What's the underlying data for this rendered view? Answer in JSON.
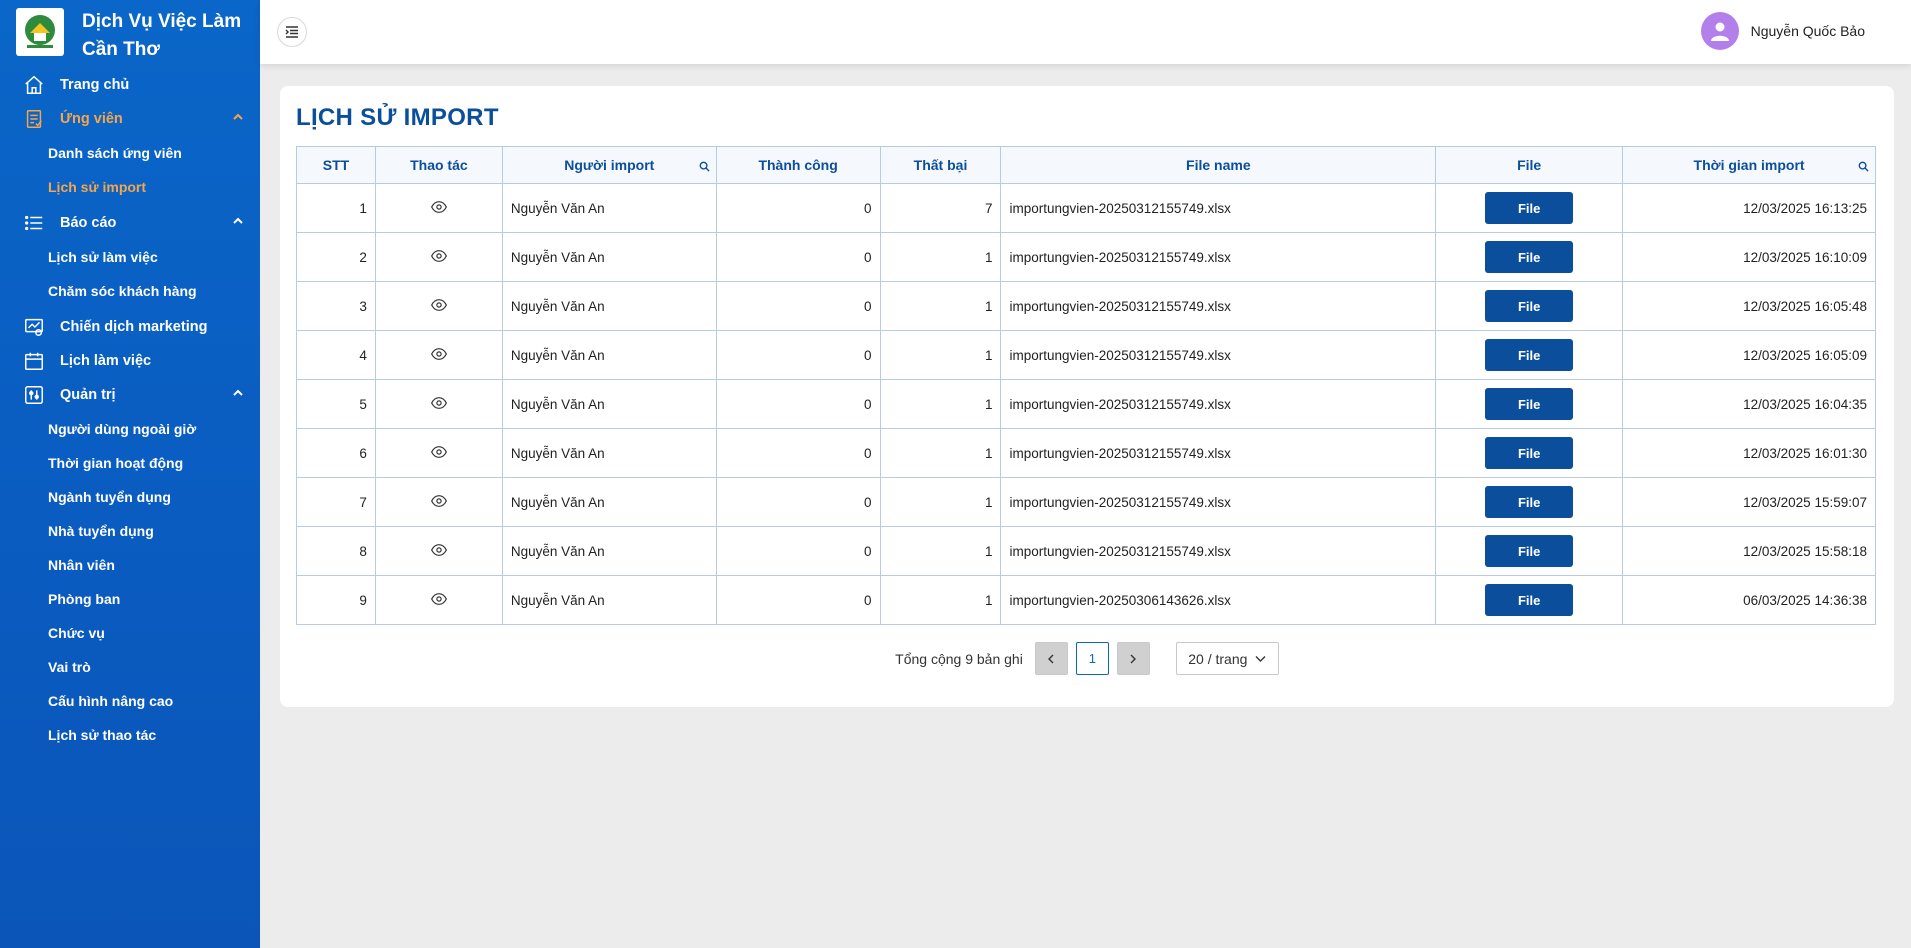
{
  "brand": {
    "name": "Dịch Vụ Việc Làm Cần Thơ"
  },
  "sidebar": {
    "items": [
      {
        "label": "Trang chủ",
        "icon": "home-icon"
      },
      {
        "label": "Ứng viên",
        "icon": "candidate-icon",
        "open": true,
        "children": [
          {
            "label": "Danh sách ứng viên"
          },
          {
            "label": "Lịch sử import",
            "active": true
          }
        ]
      },
      {
        "label": "Báo cáo",
        "icon": "list-icon",
        "open": true,
        "children": [
          {
            "label": "Lịch sử làm việc"
          },
          {
            "label": "Chăm sóc khách hàng"
          }
        ]
      },
      {
        "label": "Chiến dịch marketing",
        "icon": "marketing-icon"
      },
      {
        "label": "Lịch làm việc",
        "icon": "calendar-icon"
      },
      {
        "label": "Quản trị",
        "icon": "admin-icon",
        "open": true,
        "children": [
          {
            "label": "Người dùng ngoài giờ"
          },
          {
            "label": "Thời gian hoạt động"
          },
          {
            "label": "Ngành tuyển dụng"
          },
          {
            "label": "Nhà tuyển dụng"
          },
          {
            "label": "Nhân viên"
          },
          {
            "label": "Phòng ban"
          },
          {
            "label": "Chức vụ"
          },
          {
            "label": "Vai trò"
          },
          {
            "label": "Cấu hình nâng cao"
          },
          {
            "label": "Lịch sử thao tác"
          }
        ]
      }
    ]
  },
  "header": {
    "user_name": "Nguyễn Quốc Bảo"
  },
  "main": {
    "title": "LỊCH SỬ IMPORT",
    "columns": [
      "STT",
      "Thao tác",
      "Người import",
      "Thành công",
      "Thất bại",
      "File name",
      "File",
      "Thời gian import"
    ],
    "file_button_label": "File",
    "rows": [
      {
        "stt": "1",
        "user": "Nguyễn Văn An",
        "success": "0",
        "fail": "7",
        "file_name": "importungvien-20250312155749.xlsx",
        "time": "12/03/2025 16:13:25"
      },
      {
        "stt": "2",
        "user": "Nguyễn Văn An",
        "success": "0",
        "fail": "1",
        "file_name": "importungvien-20250312155749.xlsx",
        "time": "12/03/2025 16:10:09"
      },
      {
        "stt": "3",
        "user": "Nguyễn Văn An",
        "success": "0",
        "fail": "1",
        "file_name": "importungvien-20250312155749.xlsx",
        "time": "12/03/2025 16:05:48"
      },
      {
        "stt": "4",
        "user": "Nguyễn Văn An",
        "success": "0",
        "fail": "1",
        "file_name": "importungvien-20250312155749.xlsx",
        "time": "12/03/2025 16:05:09"
      },
      {
        "stt": "5",
        "user": "Nguyễn Văn An",
        "success": "0",
        "fail": "1",
        "file_name": "importungvien-20250312155749.xlsx",
        "time": "12/03/2025 16:04:35"
      },
      {
        "stt": "6",
        "user": "Nguyễn Văn An",
        "success": "0",
        "fail": "1",
        "file_name": "importungvien-20250312155749.xlsx",
        "time": "12/03/2025 16:01:30"
      },
      {
        "stt": "7",
        "user": "Nguyễn Văn An",
        "success": "0",
        "fail": "1",
        "file_name": "importungvien-20250312155749.xlsx",
        "time": "12/03/2025 15:59:07"
      },
      {
        "stt": "8",
        "user": "Nguyễn Văn An",
        "success": "0",
        "fail": "1",
        "file_name": "importungvien-20250312155749.xlsx",
        "time": "12/03/2025 15:58:18"
      },
      {
        "stt": "9",
        "user": "Nguyễn Văn An",
        "success": "0",
        "fail": "1",
        "file_name": "importungvien-20250306143626.xlsx",
        "time": "06/03/2025 14:36:38"
      }
    ],
    "pagination": {
      "total_text": "Tổng cộng 9 bản ghi",
      "current_page": "1",
      "page_size": "20 / trang"
    }
  },
  "colors": {
    "sidebar": "#0a66c8",
    "accent": "#f6a54a",
    "primary": "#0b4f9c"
  }
}
